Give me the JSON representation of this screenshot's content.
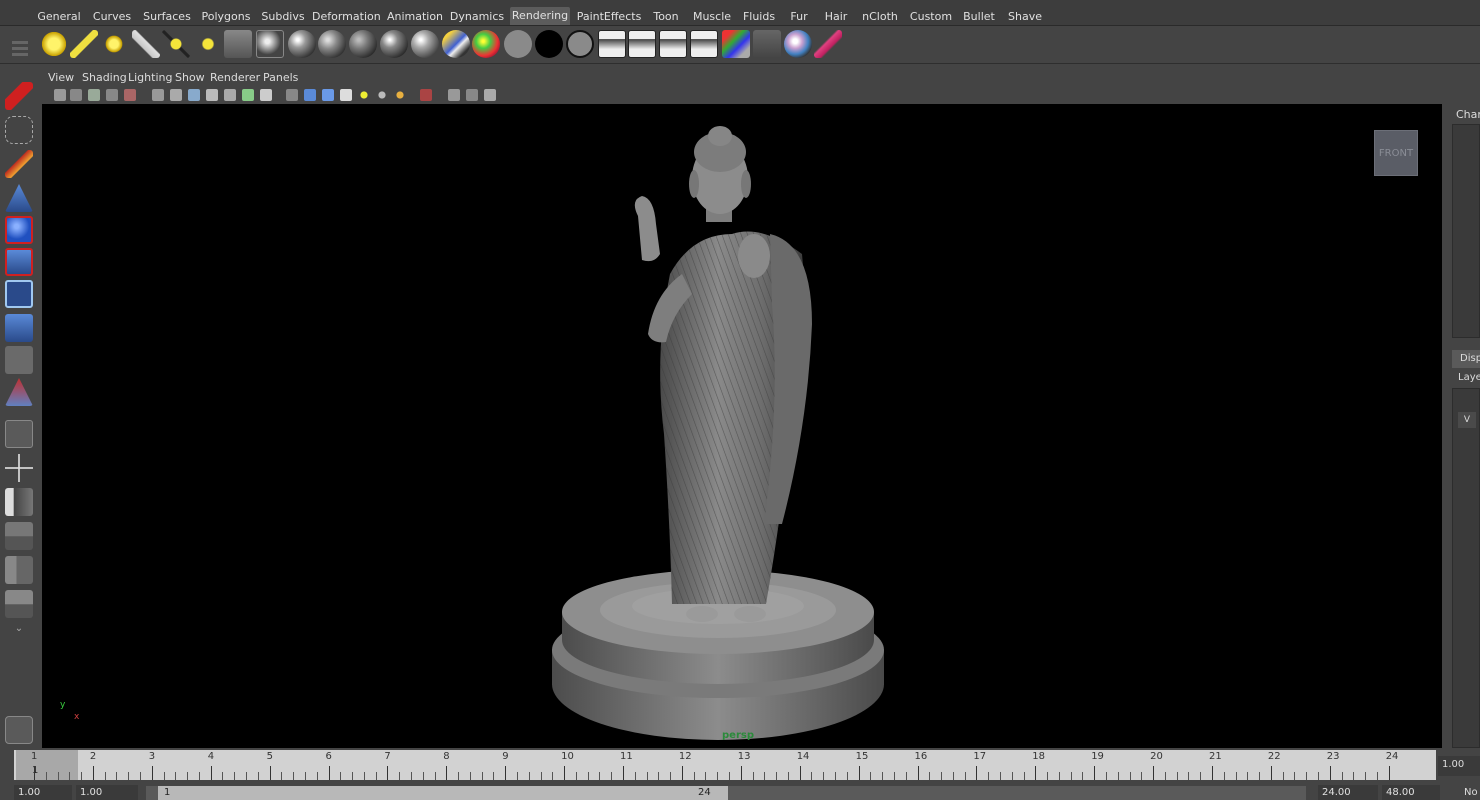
{
  "shelf": {
    "tabs": [
      "General",
      "Curves",
      "Surfaces",
      "Polygons",
      "Subdivs",
      "Deformation",
      "Animation",
      "Dynamics",
      "Rendering",
      "PaintEffects",
      "Toon",
      "Muscle",
      "Fluids",
      "Fur",
      "Hair",
      "nCloth",
      "Custom",
      "Bullet",
      "Shave"
    ],
    "active_tab": "Rendering"
  },
  "panel_menu": [
    "View",
    "Shading",
    "Lighting",
    "Show",
    "Renderer",
    "Panels"
  ],
  "viewport": {
    "viewcube_label": "FRONT",
    "camera_label": "persp",
    "axis_y": "y",
    "axis_x": "x"
  },
  "right_panel": {
    "channel_label": "Chann",
    "display_tab": "Displ",
    "layers_label": "Laye",
    "visibility_label": "V"
  },
  "timeline": {
    "ticks": [
      "1",
      "2",
      "3",
      "4",
      "5",
      "6",
      "7",
      "8",
      "9",
      "10",
      "11",
      "12",
      "13",
      "14",
      "15",
      "16",
      "17",
      "18",
      "19",
      "20",
      "21",
      "22",
      "23",
      "24"
    ],
    "current_frame": "1",
    "end_field": "1.00"
  },
  "range": {
    "start_time": "1.00",
    "playback_start": "1.00",
    "range_start_label": "1",
    "range_end_label": "24",
    "playback_end": "24.00",
    "end_time": "48.00",
    "extra": "No"
  },
  "colors": {
    "background": "#444444",
    "viewport": "#000000",
    "active_tab": "#5c5c5c",
    "timeslider": "#d2d2d2"
  }
}
